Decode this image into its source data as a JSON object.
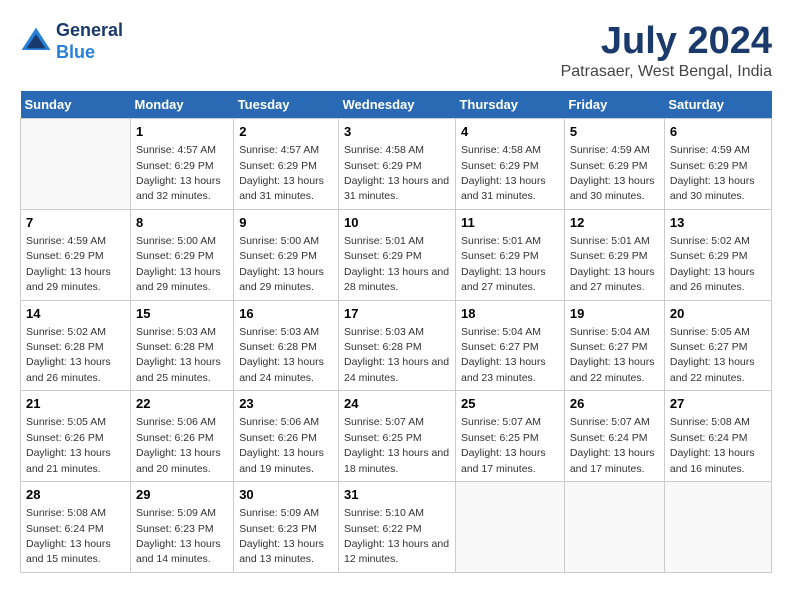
{
  "header": {
    "logo_line1": "General",
    "logo_line2": "Blue",
    "title": "July 2024",
    "subtitle": "Patrasaer, West Bengal, India"
  },
  "calendar": {
    "days_of_week": [
      "Sunday",
      "Monday",
      "Tuesday",
      "Wednesday",
      "Thursday",
      "Friday",
      "Saturday"
    ],
    "weeks": [
      [
        {
          "day": "",
          "sunrise": "",
          "sunset": "",
          "daylight": ""
        },
        {
          "day": "1",
          "sunrise": "Sunrise: 4:57 AM",
          "sunset": "Sunset: 6:29 PM",
          "daylight": "Daylight: 13 hours and 32 minutes."
        },
        {
          "day": "2",
          "sunrise": "Sunrise: 4:57 AM",
          "sunset": "Sunset: 6:29 PM",
          "daylight": "Daylight: 13 hours and 31 minutes."
        },
        {
          "day": "3",
          "sunrise": "Sunrise: 4:58 AM",
          "sunset": "Sunset: 6:29 PM",
          "daylight": "Daylight: 13 hours and 31 minutes."
        },
        {
          "day": "4",
          "sunrise": "Sunrise: 4:58 AM",
          "sunset": "Sunset: 6:29 PM",
          "daylight": "Daylight: 13 hours and 31 minutes."
        },
        {
          "day": "5",
          "sunrise": "Sunrise: 4:59 AM",
          "sunset": "Sunset: 6:29 PM",
          "daylight": "Daylight: 13 hours and 30 minutes."
        },
        {
          "day": "6",
          "sunrise": "Sunrise: 4:59 AM",
          "sunset": "Sunset: 6:29 PM",
          "daylight": "Daylight: 13 hours and 30 minutes."
        }
      ],
      [
        {
          "day": "7",
          "sunrise": "Sunrise: 4:59 AM",
          "sunset": "Sunset: 6:29 PM",
          "daylight": "Daylight: 13 hours and 29 minutes."
        },
        {
          "day": "8",
          "sunrise": "Sunrise: 5:00 AM",
          "sunset": "Sunset: 6:29 PM",
          "daylight": "Daylight: 13 hours and 29 minutes."
        },
        {
          "day": "9",
          "sunrise": "Sunrise: 5:00 AM",
          "sunset": "Sunset: 6:29 PM",
          "daylight": "Daylight: 13 hours and 29 minutes."
        },
        {
          "day": "10",
          "sunrise": "Sunrise: 5:01 AM",
          "sunset": "Sunset: 6:29 PM",
          "daylight": "Daylight: 13 hours and 28 minutes."
        },
        {
          "day": "11",
          "sunrise": "Sunrise: 5:01 AM",
          "sunset": "Sunset: 6:29 PM",
          "daylight": "Daylight: 13 hours and 27 minutes."
        },
        {
          "day": "12",
          "sunrise": "Sunrise: 5:01 AM",
          "sunset": "Sunset: 6:29 PM",
          "daylight": "Daylight: 13 hours and 27 minutes."
        },
        {
          "day": "13",
          "sunrise": "Sunrise: 5:02 AM",
          "sunset": "Sunset: 6:29 PM",
          "daylight": "Daylight: 13 hours and 26 minutes."
        }
      ],
      [
        {
          "day": "14",
          "sunrise": "Sunrise: 5:02 AM",
          "sunset": "Sunset: 6:28 PM",
          "daylight": "Daylight: 13 hours and 26 minutes."
        },
        {
          "day": "15",
          "sunrise": "Sunrise: 5:03 AM",
          "sunset": "Sunset: 6:28 PM",
          "daylight": "Daylight: 13 hours and 25 minutes."
        },
        {
          "day": "16",
          "sunrise": "Sunrise: 5:03 AM",
          "sunset": "Sunset: 6:28 PM",
          "daylight": "Daylight: 13 hours and 24 minutes."
        },
        {
          "day": "17",
          "sunrise": "Sunrise: 5:03 AM",
          "sunset": "Sunset: 6:28 PM",
          "daylight": "Daylight: 13 hours and 24 minutes."
        },
        {
          "day": "18",
          "sunrise": "Sunrise: 5:04 AM",
          "sunset": "Sunset: 6:27 PM",
          "daylight": "Daylight: 13 hours and 23 minutes."
        },
        {
          "day": "19",
          "sunrise": "Sunrise: 5:04 AM",
          "sunset": "Sunset: 6:27 PM",
          "daylight": "Daylight: 13 hours and 22 minutes."
        },
        {
          "day": "20",
          "sunrise": "Sunrise: 5:05 AM",
          "sunset": "Sunset: 6:27 PM",
          "daylight": "Daylight: 13 hours and 22 minutes."
        }
      ],
      [
        {
          "day": "21",
          "sunrise": "Sunrise: 5:05 AM",
          "sunset": "Sunset: 6:26 PM",
          "daylight": "Daylight: 13 hours and 21 minutes."
        },
        {
          "day": "22",
          "sunrise": "Sunrise: 5:06 AM",
          "sunset": "Sunset: 6:26 PM",
          "daylight": "Daylight: 13 hours and 20 minutes."
        },
        {
          "day": "23",
          "sunrise": "Sunrise: 5:06 AM",
          "sunset": "Sunset: 6:26 PM",
          "daylight": "Daylight: 13 hours and 19 minutes."
        },
        {
          "day": "24",
          "sunrise": "Sunrise: 5:07 AM",
          "sunset": "Sunset: 6:25 PM",
          "daylight": "Daylight: 13 hours and 18 minutes."
        },
        {
          "day": "25",
          "sunrise": "Sunrise: 5:07 AM",
          "sunset": "Sunset: 6:25 PM",
          "daylight": "Daylight: 13 hours and 17 minutes."
        },
        {
          "day": "26",
          "sunrise": "Sunrise: 5:07 AM",
          "sunset": "Sunset: 6:24 PM",
          "daylight": "Daylight: 13 hours and 17 minutes."
        },
        {
          "day": "27",
          "sunrise": "Sunrise: 5:08 AM",
          "sunset": "Sunset: 6:24 PM",
          "daylight": "Daylight: 13 hours and 16 minutes."
        }
      ],
      [
        {
          "day": "28",
          "sunrise": "Sunrise: 5:08 AM",
          "sunset": "Sunset: 6:24 PM",
          "daylight": "Daylight: 13 hours and 15 minutes."
        },
        {
          "day": "29",
          "sunrise": "Sunrise: 5:09 AM",
          "sunset": "Sunset: 6:23 PM",
          "daylight": "Daylight: 13 hours and 14 minutes."
        },
        {
          "day": "30",
          "sunrise": "Sunrise: 5:09 AM",
          "sunset": "Sunset: 6:23 PM",
          "daylight": "Daylight: 13 hours and 13 minutes."
        },
        {
          "day": "31",
          "sunrise": "Sunrise: 5:10 AM",
          "sunset": "Sunset: 6:22 PM",
          "daylight": "Daylight: 13 hours and 12 minutes."
        },
        {
          "day": "",
          "sunrise": "",
          "sunset": "",
          "daylight": ""
        },
        {
          "day": "",
          "sunrise": "",
          "sunset": "",
          "daylight": ""
        },
        {
          "day": "",
          "sunrise": "",
          "sunset": "",
          "daylight": ""
        }
      ]
    ]
  }
}
